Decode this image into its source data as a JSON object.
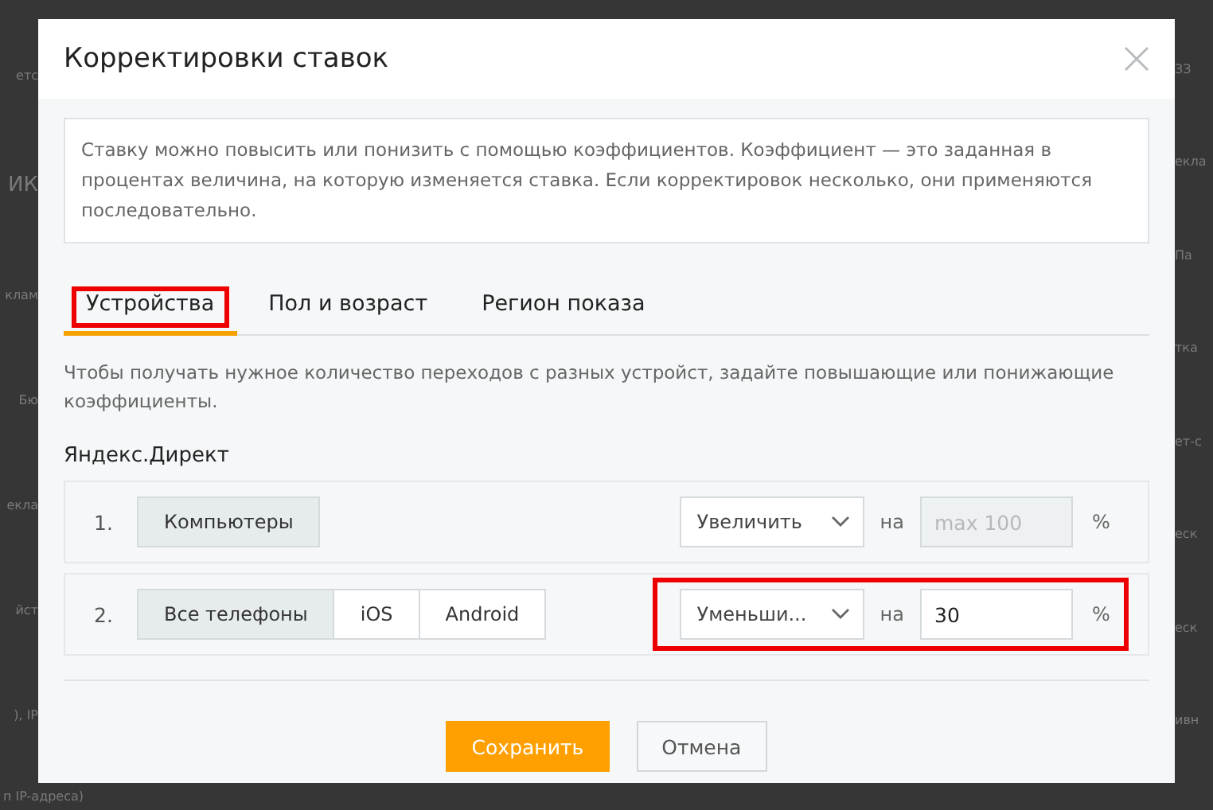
{
  "background_left": [
    "етс",
    "ИК",
    "клам",
    "Бю",
    "екла",
    "йст",
    "), IP"
  ],
  "background_right": [
    "ЗЗ",
    "екла",
    "Па",
    "тка",
    "ет-с",
    "еск",
    "еск",
    "ивн"
  ],
  "background_bottom": "п IP-адреса)",
  "dialog": {
    "title": "Корректировки ставок",
    "info": "Ставку можно повысить или понизить с помощью коэффициентов. Коэффициент — это заданная в процентах величина, на которую изменяется ставка. Если корректировок несколько, они применяются последовательно.",
    "tabs": [
      {
        "label": "Устройства",
        "selected": true,
        "highlighted": true
      },
      {
        "label": "Пол и возраст",
        "selected": false,
        "highlighted": false
      },
      {
        "label": "Регион показа",
        "selected": false,
        "highlighted": false
      }
    ],
    "hint": "Чтобы получать нужное количество переходов с разных устройст, задайте повышающие или понижающие коэффициенты.",
    "section": "Яндекс.Директ",
    "rows": [
      {
        "number": "1.",
        "devices": [
          {
            "label": "Компьютеры",
            "selected": true
          }
        ],
        "action": "Увеличить",
        "on": "на",
        "placeholder": "max 100",
        "disabled": true,
        "unit": "%",
        "highlighted": false
      },
      {
        "number": "2.",
        "devices": [
          {
            "label": "Все телефоны",
            "selected": true
          },
          {
            "label": "iOS",
            "selected": false
          },
          {
            "label": "Android",
            "selected": false
          }
        ],
        "action": "Уменьши...",
        "on": "на",
        "value": "30",
        "disabled": false,
        "unit": "%",
        "highlighted": true
      }
    ],
    "buttons": [
      {
        "label": "Сохранить",
        "kind": "primary"
      },
      {
        "label": "Отмена",
        "kind": "secondary"
      }
    ]
  }
}
